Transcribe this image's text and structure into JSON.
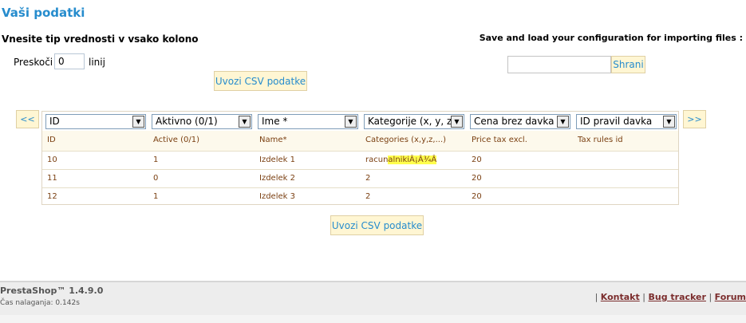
{
  "page": {
    "title": "Vaši podatki",
    "subtitle": "Vnesite tip vrednosti v vsako kolono",
    "save_label": "Save and load your configuration for importing files :",
    "skip_label": "Preskoči",
    "skip_value": "0",
    "lines_label": "linij",
    "config_save_button": "Shrani",
    "import_button": "Uvozi CSV podatke",
    "prev_button": "<<",
    "next_button": ">>"
  },
  "grid": {
    "selects": [
      "ID",
      "Aktivno (0/1)",
      "Ime *",
      "Kategorije (x, y, z",
      "Cena brez davka",
      "ID pravil davka"
    ],
    "headers": [
      "ID",
      "Active (0/1)",
      "Name*",
      "Categories (x,y,z,...)",
      "Price tax excl.",
      "Tax rules id"
    ],
    "rows": [
      {
        "cells": [
          "10",
          "1",
          "Izdelek 1",
          "racun",
          "alnikiÂ¡Â¾Â",
          "20",
          ""
        ]
      },
      {
        "cells": [
          "11",
          "0",
          "Izdelek 2",
          "2",
          "",
          "20",
          ""
        ]
      },
      {
        "cells": [
          "12",
          "1",
          "Izdelek 3",
          "2",
          "",
          "20",
          ""
        ]
      }
    ]
  },
  "footer": {
    "brand": "PrestaShop™ 1.4.9.0",
    "load_time": "Čas nalaganja: 0.142s",
    "sep1": "|",
    "link_contact": "Kontakt",
    "sep2": "|",
    "link_bug": "Bug tracker",
    "sep3": "|",
    "link_forum": "Forum"
  },
  "colors": {
    "accent": "#268ccd",
    "button_bg": "#fff6d3",
    "highlight": "#ffff4d",
    "cell_text": "#7a3f11"
  }
}
